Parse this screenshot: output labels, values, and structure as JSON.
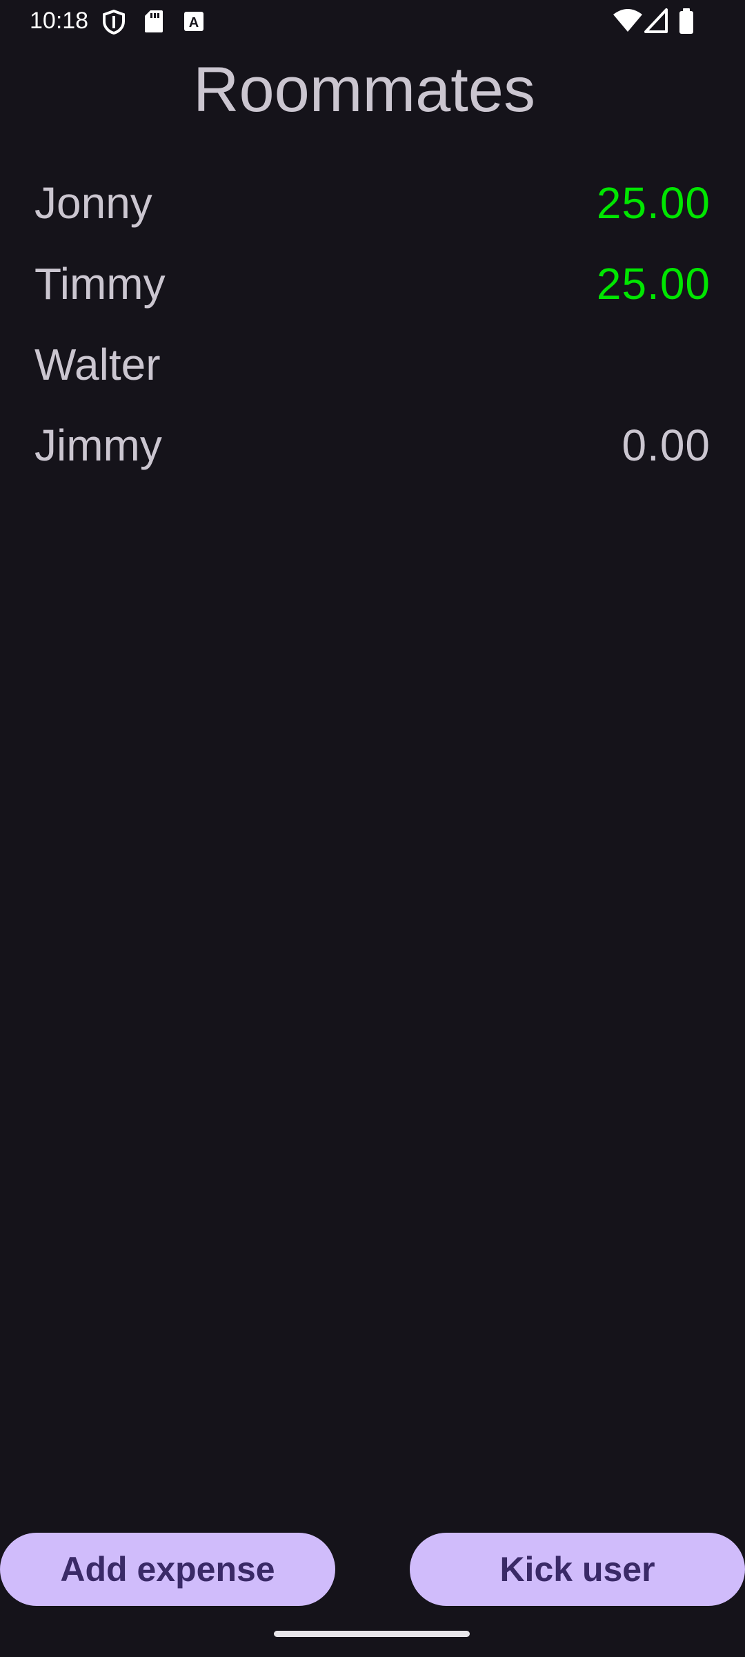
{
  "status_bar": {
    "time": "10:18",
    "left_icons": [
      "shield-icon",
      "sd-card-icon",
      "a-box-icon"
    ],
    "right_icons": [
      "wifi-icon",
      "cell-signal-icon",
      "battery-icon"
    ]
  },
  "page": {
    "title": "Roommates"
  },
  "roommates": [
    {
      "name": "Jonny",
      "amount": "25.00",
      "status": "positive"
    },
    {
      "name": "Timmy",
      "amount": "25.00",
      "status": "positive"
    },
    {
      "name": "Walter",
      "amount": "",
      "status": "none"
    },
    {
      "name": "Jimmy",
      "amount": "0.00",
      "status": "neutral"
    }
  ],
  "actions": {
    "add_expense_label": "Add expense",
    "kick_user_label": "Kick user"
  },
  "colors": {
    "background": "#15131a",
    "text": "#cbc6d0",
    "positive_amount": "#00e600",
    "button_bg": "#d0bcfb",
    "button_text": "#3a2a67"
  }
}
